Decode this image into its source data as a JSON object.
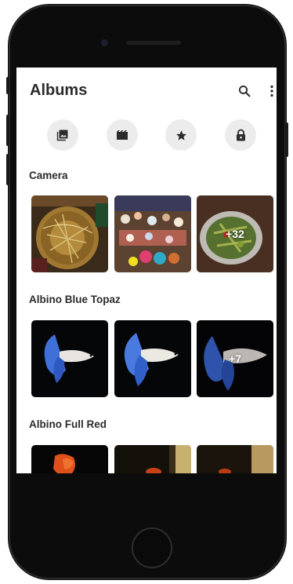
{
  "header": {
    "title": "Albums"
  },
  "icons": {
    "search": "search-icon",
    "more": "more-vert-icon",
    "quick": [
      "photo-icon",
      "video-icon",
      "star-icon",
      "lock-icon"
    ]
  },
  "albums": [
    {
      "name": "Camera",
      "extra_count": "+32"
    },
    {
      "name": "Albino Blue Topaz",
      "extra_count": "+7"
    },
    {
      "name": "Albino Full Red"
    }
  ],
  "colors": {
    "icon": "#2b2b2b",
    "quick_bg": "#ececec",
    "betta_blue": "#3f6fd8"
  }
}
